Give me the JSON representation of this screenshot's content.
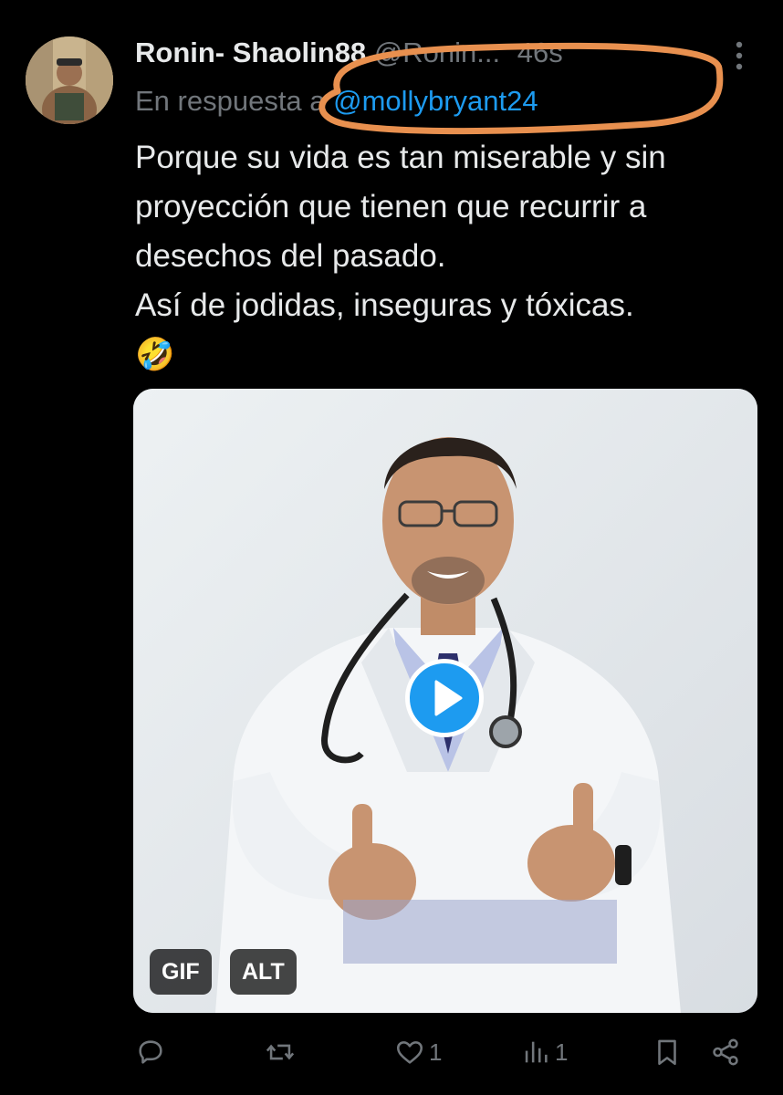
{
  "tweet": {
    "display_name": "Ronin- Shaolin88",
    "handle": "@Ronin...",
    "timestamp": "46s",
    "reply_prefix": "En respuesta a ",
    "reply_mention": "@mollybryant24",
    "text_lines": [
      "Porque su vida es tan miserable y sin",
      "proyección que tienen que recurrir a",
      "desechos del pasado.",
      "Así de jodidas, inseguras y tóxicas.",
      "🤣"
    ],
    "media": {
      "type": "gif",
      "gif_label": "GIF",
      "alt_label": "ALT"
    },
    "actions": {
      "reply_count": "",
      "retweet_count": "",
      "like_count": "1",
      "views_count": "1"
    }
  },
  "colors": {
    "background": "#000000",
    "text_primary": "#e7e9ea",
    "text_secondary": "#71767b",
    "accent": "#1d9bf0",
    "annotation": "#e8904f"
  },
  "icons": [
    "more-vertical-icon",
    "reply-icon",
    "retweet-icon",
    "like-icon",
    "views-icon",
    "bookmark-icon",
    "share-icon",
    "play-icon"
  ]
}
